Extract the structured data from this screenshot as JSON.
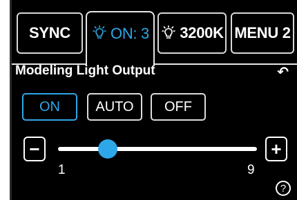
{
  "tabs": [
    {
      "label": "SYNC",
      "icon": null,
      "active": false
    },
    {
      "label": "ON: 3",
      "icon": "bulb-icon",
      "active": true
    },
    {
      "label": "3200K",
      "icon": "bulb-icon",
      "active": false
    },
    {
      "label": "MENU 2",
      "icon": null,
      "active": false
    }
  ],
  "header": {
    "title": "Modeling Light Output",
    "back_icon": "return-arrow-icon",
    "back_symbol": "↶"
  },
  "modes": {
    "on_label": "ON",
    "auto_label": "AUTO",
    "off_label": "OFF",
    "selected": "ON"
  },
  "slider": {
    "min": 1,
    "max": 9,
    "value": 3,
    "min_label": "1",
    "max_label": "9",
    "minus_symbol": "−",
    "plus_symbol": "+"
  },
  "help": {
    "symbol": "?"
  },
  "colors": {
    "accent": "#2ea7e8",
    "background": "#000000",
    "foreground": "#ffffff"
  }
}
